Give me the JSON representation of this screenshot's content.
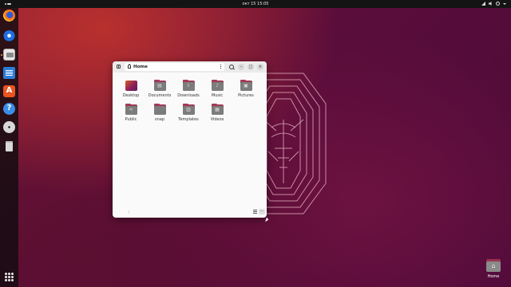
{
  "topbar": {
    "clock": "окт 15  15:05"
  },
  "dock": {
    "apps": [
      {
        "name": "Firefox",
        "icon": "firefox-icon"
      },
      {
        "name": "Thunderbird",
        "icon": "thunderbird-icon"
      },
      {
        "name": "Files",
        "icon": "files-icon"
      },
      {
        "name": "LibreOffice Writer",
        "icon": "writer-icon"
      },
      {
        "name": "App Center",
        "icon": "app-center-icon"
      },
      {
        "name": "Help",
        "icon": "help-icon"
      },
      {
        "name": "Disc",
        "icon": "disc-icon"
      },
      {
        "name": "Trash",
        "icon": "trash-icon"
      }
    ],
    "show_apps_icon": "grid-icon"
  },
  "window": {
    "path_label": "Home",
    "buttons": {
      "minimize": "–",
      "maximize": "□",
      "close": "×"
    },
    "items": [
      {
        "label": "Desktop",
        "glyph": ""
      },
      {
        "label": "Documents",
        "glyph": "▤"
      },
      {
        "label": "Downloads",
        "glyph": "⇩"
      },
      {
        "label": "Music",
        "glyph": "♪"
      },
      {
        "label": "Pictures",
        "glyph": "▣"
      },
      {
        "label": "Public",
        "glyph": "⋖"
      },
      {
        "label": "snap",
        "glyph": ""
      },
      {
        "label": "Templates",
        "glyph": "▥"
      },
      {
        "label": "Videos",
        "glyph": "▦"
      }
    ],
    "status": {
      "more": "⋯"
    }
  },
  "desktop": {
    "home_label": "Home",
    "home_glyph": "⌂"
  },
  "colors": {
    "accent": "#e95420",
    "folder_tab": "#a23a55",
    "folder_body": "#7c7c7c"
  }
}
